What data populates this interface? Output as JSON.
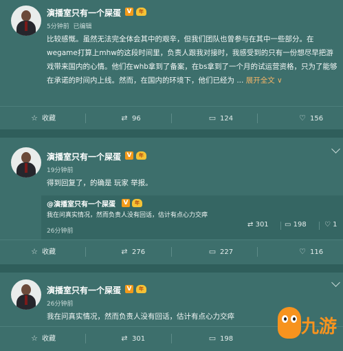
{
  "posts": [
    {
      "author": "演播室只有一个屎蛋",
      "v_badge": "V",
      "crown_badge": "年",
      "time": "5分钟前",
      "edited": "已编辑",
      "text": "比较感慨。虽然无法完全体会其中的艰辛，但我们团队也曾参与在其中一些部分。在wegame打算上mhw的这段时间里，负责人跟我对接时，我感受到的只有一份想尽早把游戏带来国内的心情。他们在whb拿到了备案，在bs拿到了一个月的试运营资格，只为了能够在承诺的时间内上线。然而，在国内的环境下，他们已经为 ...",
      "expand": "展开全文",
      "expand_arrow": "∨",
      "actions": {
        "favorite": "收藏",
        "repost": "96",
        "comment": "124",
        "like": "156"
      }
    },
    {
      "author": "演播室只有一个屎蛋",
      "v_badge": "V",
      "crown_badge": "年",
      "time": "19分钟前",
      "text": "得到回复了，的确是   玩家   举报。",
      "quote": {
        "author": "@演播室只有一个屎蛋",
        "v_badge": "V",
        "crown_badge": "年",
        "text": "我在问真实情况，然而负责人没有回话，估计有点心力交瘁",
        "time": "26分钟前",
        "repost": "301",
        "comment": "198",
        "like": "1"
      },
      "actions": {
        "favorite": "收藏",
        "repost": "276",
        "comment": "227",
        "like": "116"
      }
    },
    {
      "author": "演播室只有一个屎蛋",
      "v_badge": "V",
      "crown_badge": "年",
      "time": "26分钟前",
      "text": "我在问真实情况，然而负责人没有回话，估计有点心力交瘁",
      "actions": {
        "favorite": "收藏",
        "repost": "301",
        "comment": "198"
      }
    }
  ],
  "watermark": {
    "text": "九游"
  },
  "icons": {
    "favorite": "star-icon",
    "repost": "repost-icon",
    "comment": "comment-icon",
    "like": "thumbs-up-icon",
    "menu": "chevron-down-icon"
  },
  "colors": {
    "background": "#3d6f6c",
    "link": "#f3b468",
    "v_badge": "#f29a1a",
    "logo": "#f7931e"
  }
}
